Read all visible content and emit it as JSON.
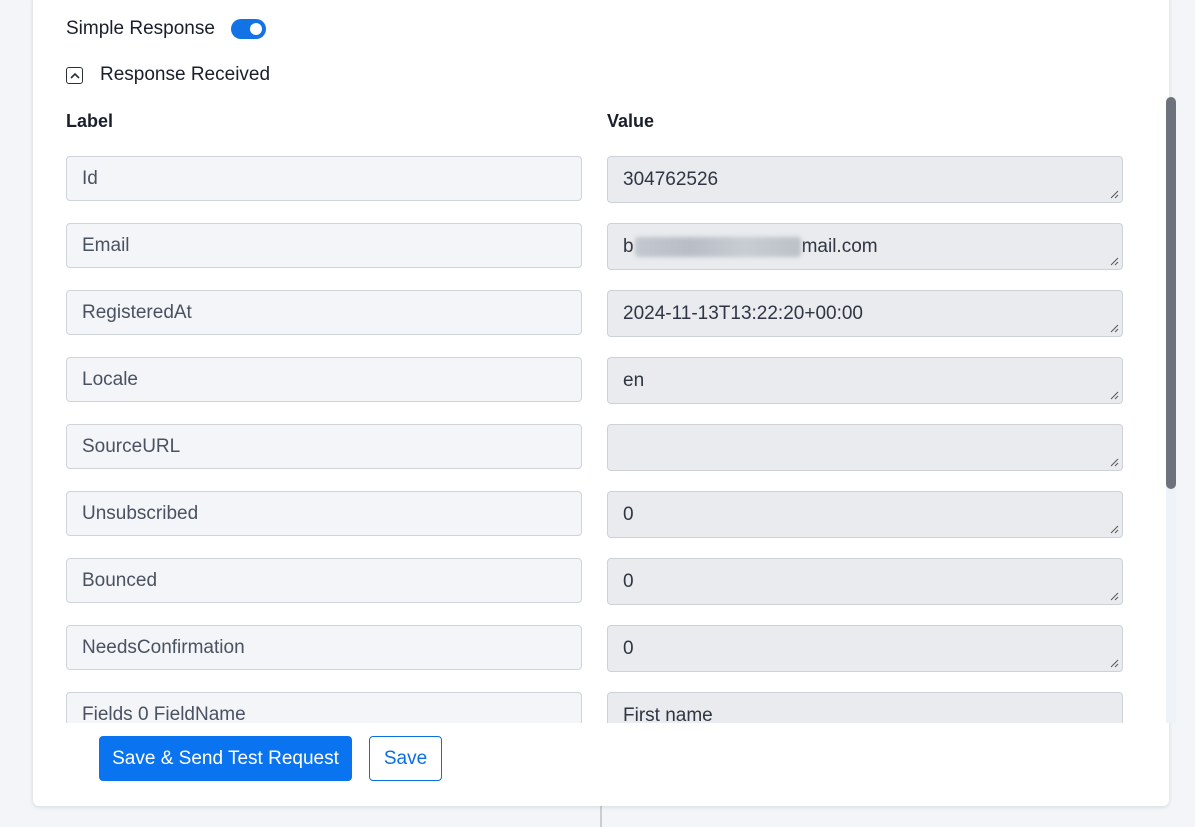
{
  "settings": {
    "simple_response_label": "Simple Response",
    "simple_response_enabled": true,
    "section_title": "Response Received"
  },
  "columns": {
    "label_header": "Label",
    "value_header": "Value"
  },
  "rows": [
    {
      "label": "Id",
      "value": "304762526"
    },
    {
      "label": "Email",
      "value_prefix": "b",
      "value_suffix": "mail.com"
    },
    {
      "label": "RegisteredAt",
      "value": "2024-11-13T13:22:20+00:00"
    },
    {
      "label": "Locale",
      "value": "en"
    },
    {
      "label": "SourceURL",
      "value": ""
    },
    {
      "label": "Unsubscribed",
      "value": "0"
    },
    {
      "label": "Bounced",
      "value": "0"
    },
    {
      "label": "NeedsConfirmation",
      "value": "0"
    },
    {
      "label": "Fields 0 FieldName",
      "value": "First name"
    }
  ],
  "actions": {
    "save_send_label": "Save & Send Test Request",
    "save_label": "Save"
  },
  "colors": {
    "accent": "#0a74f0",
    "toggle_on": "#1272e6",
    "field_bg": "#f3f5f8",
    "value_bg": "#e9ebee"
  }
}
